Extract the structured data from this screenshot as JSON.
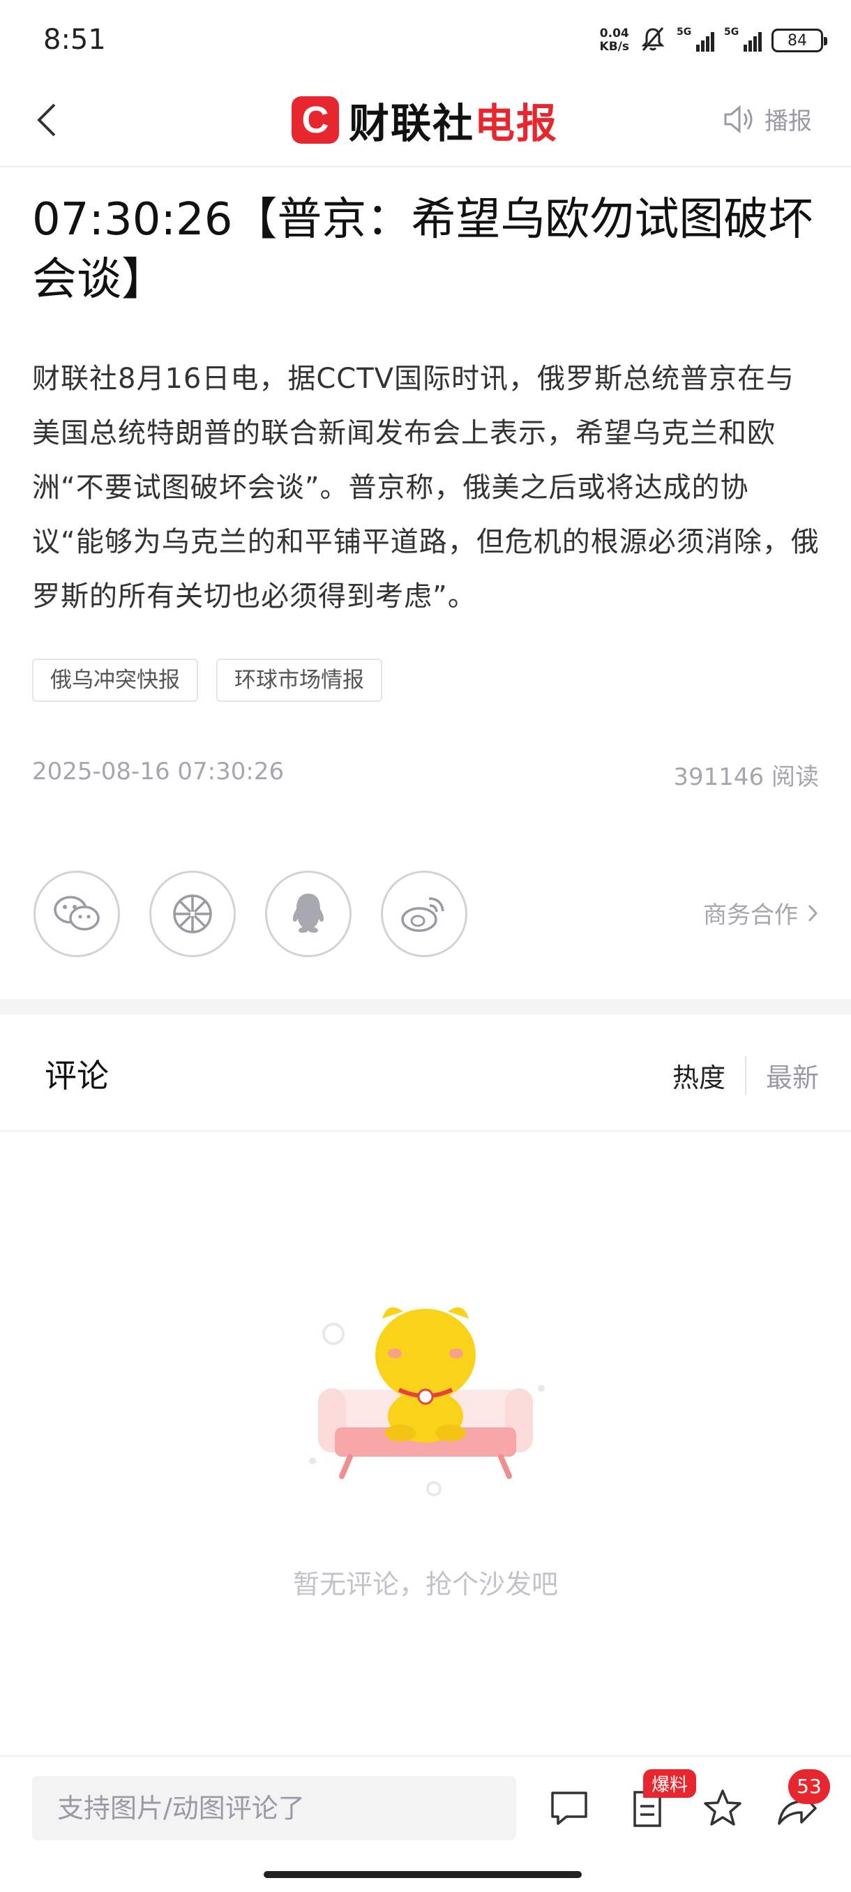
{
  "status": {
    "time": "8:51",
    "net_speed_value": "0.04",
    "net_speed_unit": "KB/s",
    "signal1": "5G",
    "signal2": "5G",
    "battery": "84"
  },
  "nav": {
    "logo_mark": "C",
    "logo_text_a": "财联社",
    "logo_text_b": "电报",
    "broadcast_label": "播报"
  },
  "article": {
    "title": "07:30:26【普京：希望乌欧勿试图破坏会谈】",
    "body": "财联社8月16日电，据CCTV国际时讯，俄罗斯总统普京在与美国总统特朗普的联合新闻发布会上表示，希望乌克兰和欧洲“不要试图破坏会谈”。普京称，俄美之后或将达成的协议“能够为乌克兰的和平铺平道路，但危机的根源必须消除，俄罗斯的所有关切也必须得到考虑”。",
    "tags": [
      "俄乌冲突快报",
      "环球市场情报"
    ],
    "datetime": "2025-08-16 07:30:26",
    "reads": "391146 阅读"
  },
  "share": {
    "icons": [
      "wechat-icon",
      "moments-icon",
      "qq-icon",
      "weibo-icon"
    ],
    "business_label": "商务合作"
  },
  "comments": {
    "title": "评论",
    "sort_hot": "热度",
    "sort_new": "最新",
    "empty_text": "暂无评论，抢个沙发吧"
  },
  "bottom_bar": {
    "input_placeholder": "支持图片/动图评论了",
    "tip_badge": "爆料",
    "share_count": "53"
  },
  "colors": {
    "brand_red": "#e8262d",
    "muted": "#a6a6ae"
  }
}
